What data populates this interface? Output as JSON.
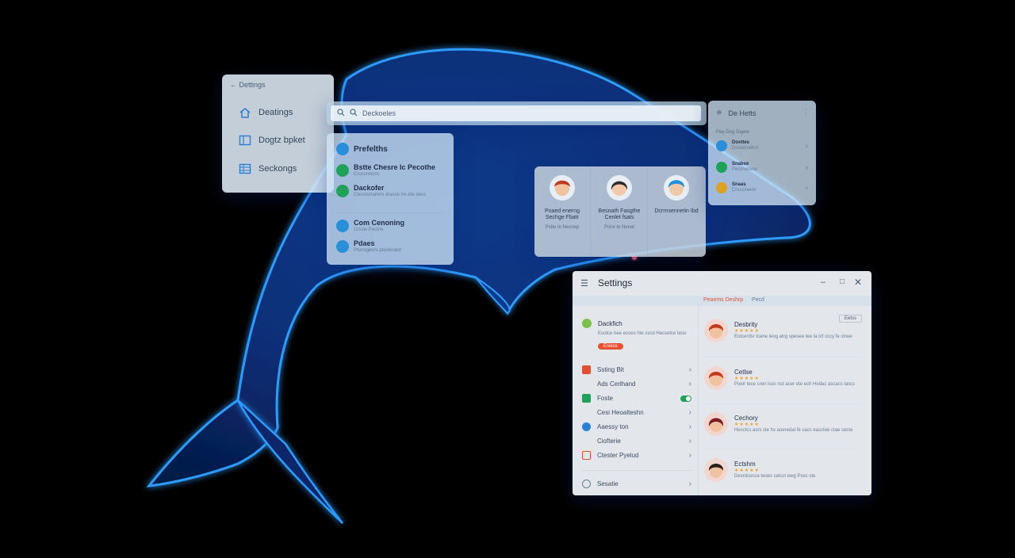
{
  "nav_panel": {
    "header": "Dettings",
    "items": [
      {
        "label": "Deatings",
        "icon": "house-icon"
      },
      {
        "label": "Dogtz bpket",
        "icon": "layout-icon"
      },
      {
        "label": "Seckongs",
        "icon": "grid-icon"
      }
    ]
  },
  "search": {
    "value": "Deckoeles"
  },
  "list_panel": {
    "items": [
      {
        "title": "Prefelths",
        "sub": "",
        "icon_color": "#2a8fd8"
      },
      {
        "title": "Bstte Chesre Ic Pecothe",
        "sub": "Crosuretons",
        "icon_color": "#1fa15a"
      },
      {
        "title": "Dackofer",
        "sub": "Clesstortamns drasce tre ete decs",
        "icon_color": "#1fa15a"
      },
      {
        "title": "Com Cenoning",
        "sub": "Crssle Pectne",
        "icon_color": "#2a8fd8"
      },
      {
        "title": "Pdaes",
        "sub": "Ptenegeers ptaolesled",
        "icon_color": "#2a8fd8"
      }
    ]
  },
  "contacts": [
    {
      "name": "Poaed enerng Sechge Fbatr",
      "sub": "Pcbe te Nesnep",
      "hair": "#c03a1e",
      "skin": "#f0c2a0"
    },
    {
      "name": "Besnath Fasgthe Cenlet fsats",
      "sub": "Pclre te Nenat",
      "hair": "#2a2a2e",
      "skin": "#f2c8a8"
    },
    {
      "name": "Dcrrnsennetin Ibd",
      "sub": "",
      "hair": "#1f8fe0",
      "skin": "#f0c8a8"
    }
  ],
  "right_panel": {
    "title": "De Hetts",
    "subtitle": "Pep Deg Digeie",
    "items": [
      {
        "title": "Doxttes",
        "sub": "Dssletrsebrn",
        "icon_color": "#2a8fd8"
      },
      {
        "title": "Snabse",
        "sub": "Peccnerene",
        "icon_color": "#1fa15a"
      },
      {
        "title": "Snaas",
        "sub": "Crsscinerer",
        "icon_color": "#e0a020"
      }
    ]
  },
  "settings": {
    "title": "Settings",
    "tabs": [
      "Peaems Deshrp",
      "Pecd"
    ],
    "profile": {
      "title": "Dackfich",
      "desc": "Esotce hee ecoes hte svcd Hecsetce teso",
      "button": "Esiess"
    },
    "menu": [
      {
        "label": "Ssting Bit",
        "icon": "list-icon",
        "icon_color": "#e05030",
        "control": "chevron"
      },
      {
        "label": "Ads Cerlhand",
        "icon": "",
        "icon_color": "",
        "control": "chevron"
      },
      {
        "label": "Foste",
        "icon": "image-icon",
        "icon_color": "#1fa15a",
        "control": "toggle"
      },
      {
        "label": "Cesi Heoalteshn",
        "icon": "",
        "icon_color": "",
        "control": "chevron"
      },
      {
        "label": "Aaessy ton",
        "icon": "shield-icon",
        "icon_color": "#2a7fd8",
        "control": "chevron"
      },
      {
        "label": "Ciofterie",
        "icon": "",
        "icon_color": "",
        "control": "chevron"
      },
      {
        "label": "Ctester Pyelud",
        "icon": "calendar-icon",
        "icon_color": "#e05030",
        "control": "chevron"
      },
      {
        "label": "Sesatie",
        "icon": "tag-icon",
        "icon_color": "#6a7c92",
        "control": "chevron"
      }
    ],
    "edit_button": "Eetss",
    "reviews": [
      {
        "name": "Desbrity",
        "rating": 5,
        "text": "Eotcerdsr tcane leog atrg spesee tee ta lcf cccy fe clnee",
        "hair": "#c03a1e"
      },
      {
        "name": "Cetlse",
        "rating": 5,
        "text": "Poeir tece cren lsos rsd acer ete ech Hedac ascacs lascs",
        "hair": "#c03a1e"
      },
      {
        "name": "Cechory",
        "rating": 5,
        "text": "Hesctcs asrs ste hs aoeredal fe cacs easctee ctae secte",
        "hair": "#7a1e2a"
      },
      {
        "name": "Ectshm",
        "rating": 5,
        "text": "Desrdcocca teoes celcct ewg Psec cte",
        "hair": "#2a1e1a"
      }
    ]
  }
}
